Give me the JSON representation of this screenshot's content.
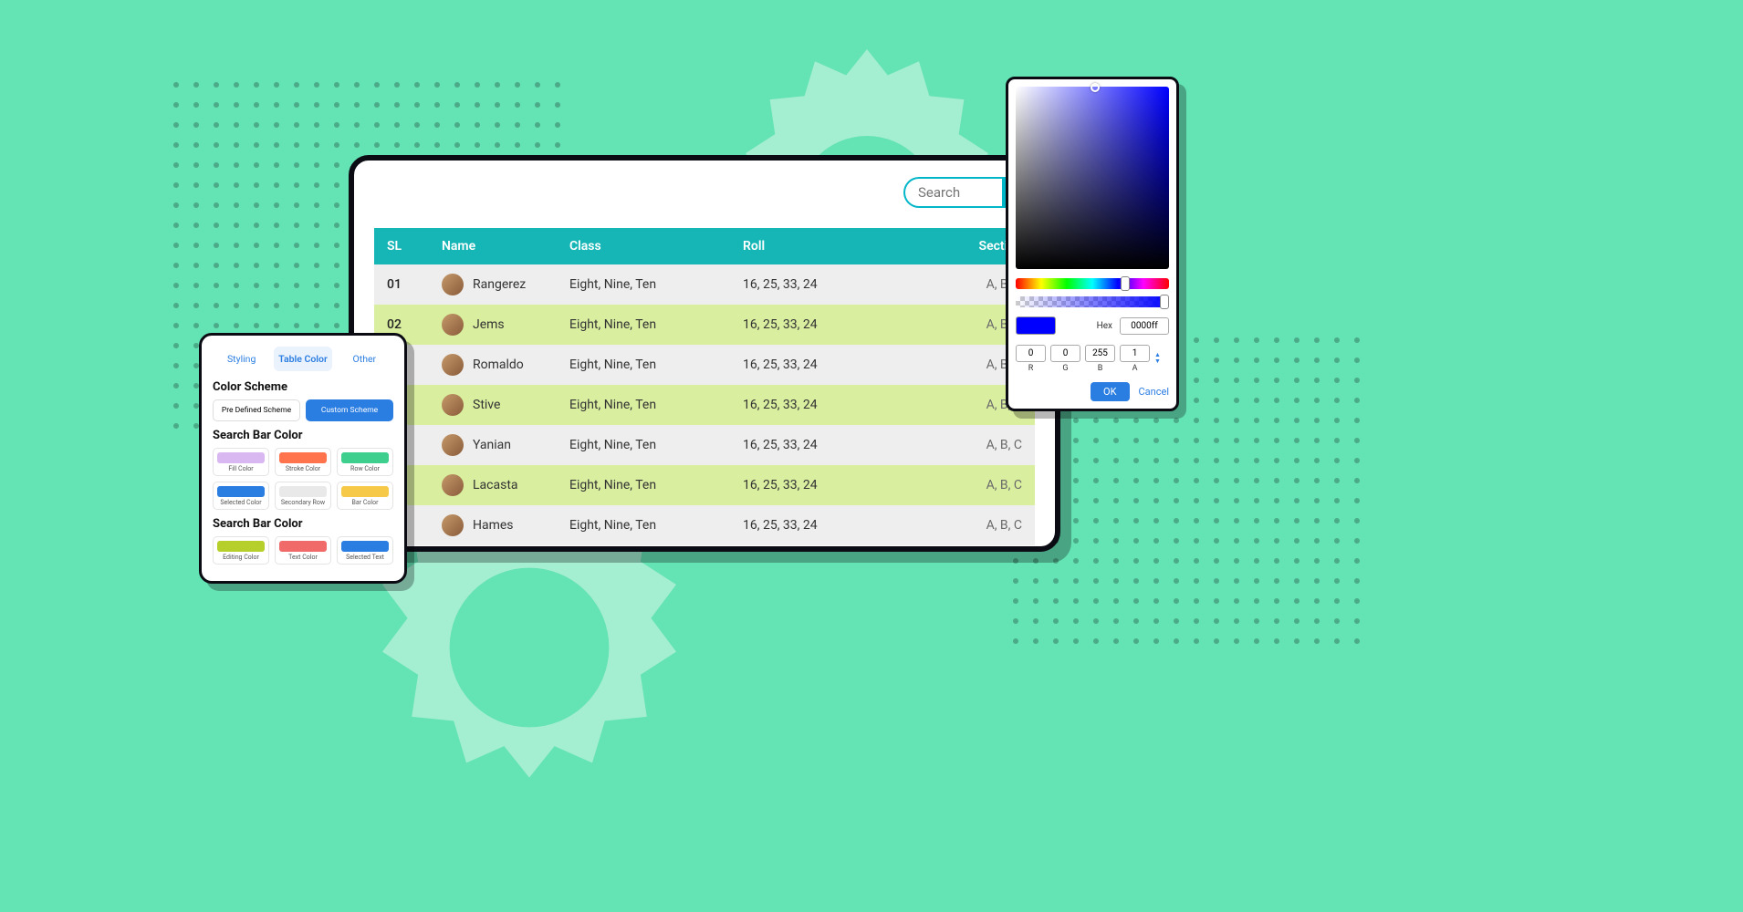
{
  "search": {
    "placeholder": "Search"
  },
  "table": {
    "headers": {
      "sl": "SL",
      "name": "Name",
      "class": "Class",
      "roll": "Roll",
      "section": "Section"
    },
    "rows": [
      {
        "sl": "01",
        "name": "Rangerez",
        "class": "Eight, Nine, Ten",
        "roll": "16, 25, 33, 24",
        "section": "A, B, C"
      },
      {
        "sl": "02",
        "name": "Jems",
        "class": "Eight, Nine, Ten",
        "roll": "16, 25, 33, 24",
        "section": "A, B, C"
      },
      {
        "sl": "",
        "name": "Romaldo",
        "class": "Eight, Nine, Ten",
        "roll": "16, 25, 33, 24",
        "section": "A, B, C"
      },
      {
        "sl": "",
        "name": "Stive",
        "class": "Eight, Nine, Ten",
        "roll": "16, 25, 33, 24",
        "section": "A, B, C"
      },
      {
        "sl": "",
        "name": "Yanian",
        "class": "Eight, Nine, Ten",
        "roll": "16, 25, 33, 24",
        "section": "A, B, C"
      },
      {
        "sl": "",
        "name": "Lacasta",
        "class": "Eight, Nine, Ten",
        "roll": "16, 25, 33, 24",
        "section": "A, B, C"
      },
      {
        "sl": "",
        "name": "Hames",
        "class": "Eight, Nine, Ten",
        "roll": "16, 25, 33, 24",
        "section": "A, B, C"
      }
    ]
  },
  "settings": {
    "tabs": {
      "styling": "Styling",
      "table_color": "Table Color",
      "other": "Other"
    },
    "section1": "Color Scheme",
    "predefined": "Pre Defined Scheme",
    "custom": "Custom Scheme",
    "section2": "Search Bar Color",
    "section3": "Search Bar Color",
    "swatches1": [
      {
        "label": "Fill Color",
        "hex": "#d9b8f2"
      },
      {
        "label": "Stroke Color",
        "hex": "#ff734d"
      },
      {
        "label": "Row Color",
        "hex": "#3ecf8e"
      },
      {
        "label": "Selected Color",
        "hex": "#2a7de1"
      },
      {
        "label": "Secondary Row",
        "hex": "#e9e9e9"
      },
      {
        "label": "Bar Color",
        "hex": "#f7c948"
      }
    ],
    "swatches2": [
      {
        "label": "Editing Color",
        "hex": "#b6cf2a"
      },
      {
        "label": "Text Color",
        "hex": "#f06a6a"
      },
      {
        "label": "Selected Text",
        "hex": "#2a7de1"
      }
    ]
  },
  "picker": {
    "hex_label": "Hex",
    "hex": "0000ff",
    "r": "0",
    "g": "0",
    "b": "255",
    "a": "1",
    "r_label": "R",
    "g_label": "G",
    "b_label": "B",
    "a_label": "A",
    "ok": "OK",
    "cancel": "Cancel"
  }
}
